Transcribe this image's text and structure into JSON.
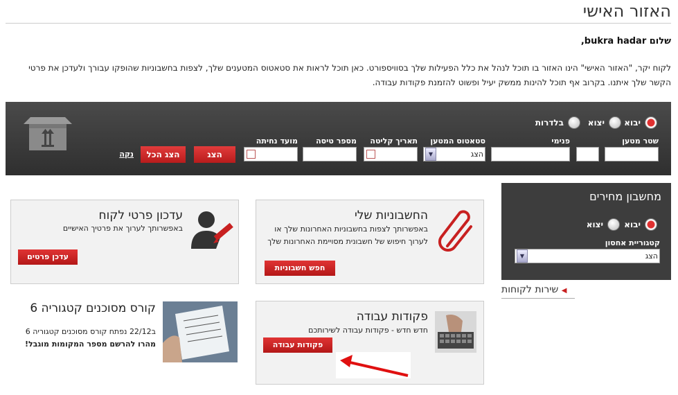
{
  "page": {
    "title": "האזור האישי",
    "greeting": "שלום bukra hadar,",
    "intro": "לקוח יקר, \"האזור האישי\" הינו האזור בו תוכל לנהל את כלל הפעילות שלך בסוויספורט. כאן תוכל לראות את סטאטוס המטענים שלך, לצפות בחשבוניות שהופקו עבורך ולעדכן את פרטי הקשר שלך איתנו. בקרוב אף תוכל להינות  ממשק יעיל ופשוט להזמנת פקודות עבודה."
  },
  "search": {
    "radios": [
      {
        "label": "יבוא",
        "selected": true
      },
      {
        "label": "יצוא",
        "selected": false
      },
      {
        "label": "בלדרות",
        "selected": false
      }
    ],
    "fields": {
      "shipment_doc": "שטר מטען",
      "internal": "פנימי",
      "status": "סטאטוס המטען",
      "status_value": "הצג",
      "receipt_date": "תאריך קליטה",
      "flight_number": "מספר טיסה",
      "landing_date": "מועד נחיתה"
    },
    "show_button": "הצג",
    "show_all_button": "הצג הכל",
    "clear_link": "נקה"
  },
  "price_calc": {
    "title": "מחשבון מחירים",
    "radios": [
      {
        "label": "יבוא",
        "selected": true
      },
      {
        "label": "יצוא",
        "selected": false
      }
    ],
    "category_label": "קטגוריית אחסון",
    "category_value": "הצג"
  },
  "customer_service": {
    "label": "שירות לקוחות"
  },
  "cards": {
    "invoices": {
      "title": "החשבוניות שלי",
      "text": "באפשרותך לצפות בחשבוניות האחרונות שלך או לערוך חיפוש של חשבונית מסויימת האחרונות שלך",
      "button": "חפש חשבוניות"
    },
    "update_details": {
      "title": "עדכון פרטי לקוח",
      "text": "באפשרותך לערוך את פרטיך האישיים",
      "button": "עדכן פרטים"
    },
    "work_orders": {
      "title": "פקודות עבודה",
      "text": "חדש חדש - פקודות עבודה לשירותכם",
      "button": "פקודות עבודה"
    },
    "course": {
      "title": "קורס מסוכנים קטגוריה 6",
      "line1": "ב22/12 נפתח קורס מסוכנים קטגוריה 6",
      "line2": "מהרו להרשם מספר המקומות מוגבל!"
    }
  },
  "colors": {
    "accent": "#c82020",
    "band": "#3a3a3a"
  }
}
